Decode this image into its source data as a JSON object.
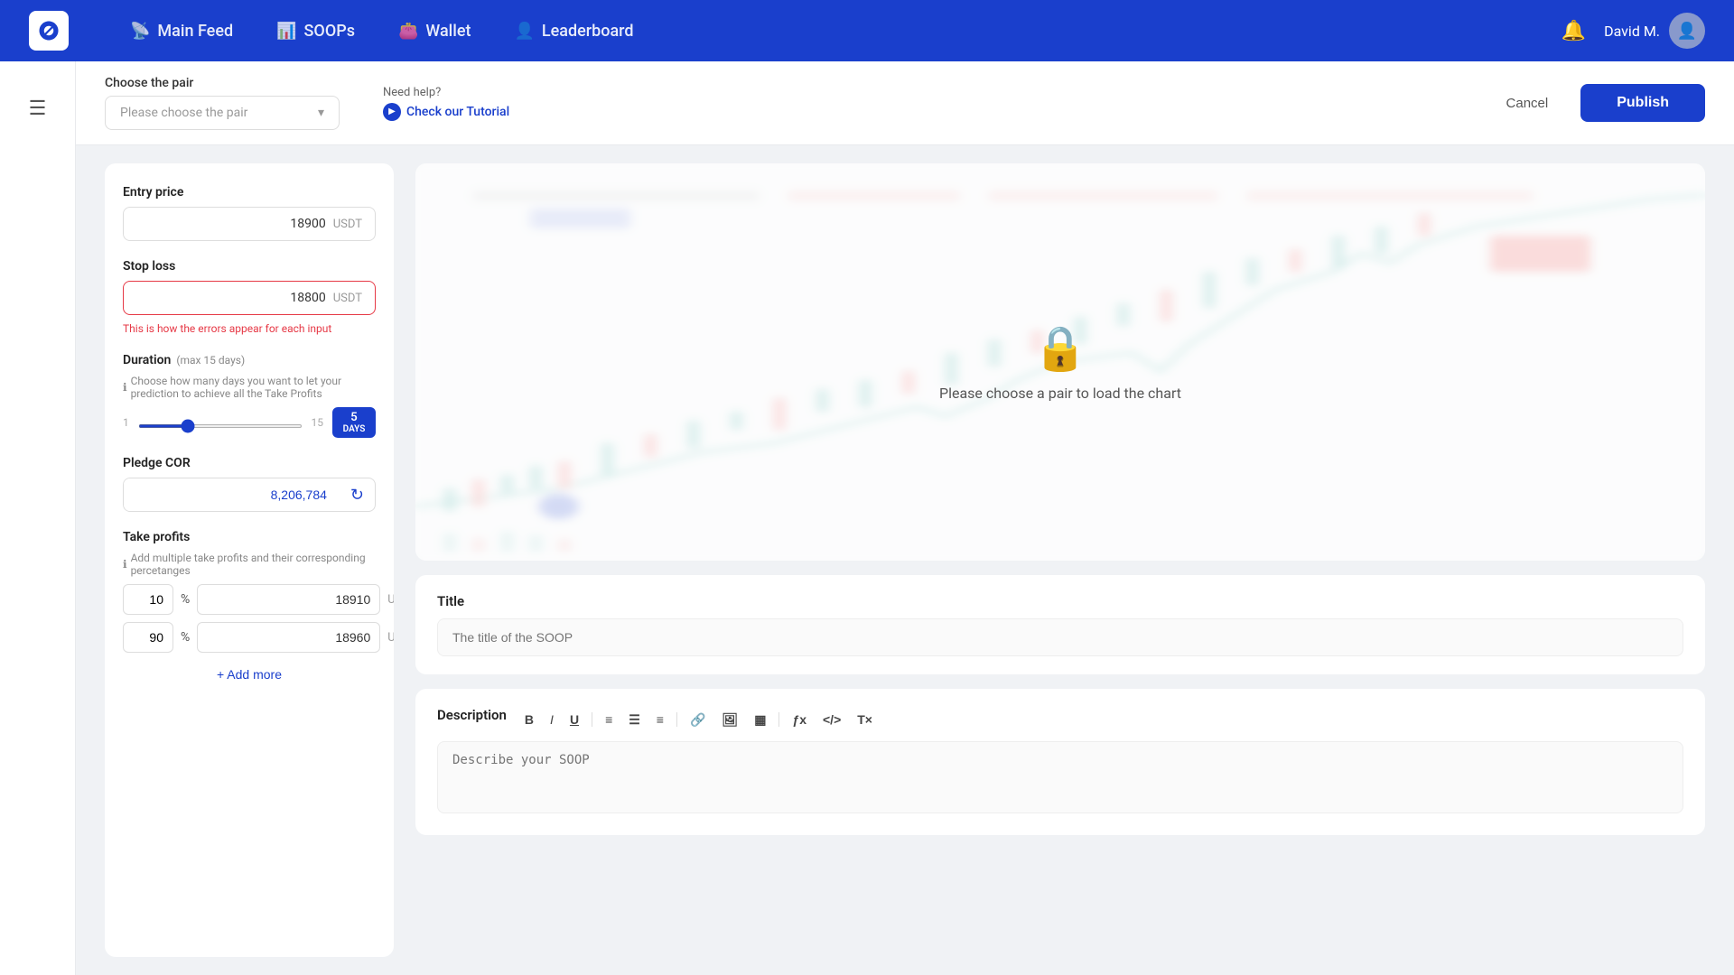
{
  "app": {
    "logo_alt": "Cryptoshots Logo"
  },
  "navbar": {
    "items": [
      {
        "id": "main-feed",
        "label": "Main Feed",
        "icon": "wifi"
      },
      {
        "id": "soops",
        "label": "SOOPs",
        "icon": "chart"
      },
      {
        "id": "wallet",
        "label": "Wallet",
        "icon": "wallet"
      },
      {
        "id": "leaderboard",
        "label": "Leaderboard",
        "icon": "person"
      }
    ],
    "user_name": "David M.",
    "bell_icon": "🔔"
  },
  "sub_header": {
    "pair_label": "Choose the pair",
    "pair_placeholder": "Please choose the pair",
    "help_label": "Need help?",
    "help_link_text": "Check our Tutorial",
    "cancel_label": "Cancel",
    "publish_label": "Publish"
  },
  "left_panel": {
    "entry_price": {
      "label": "Entry price",
      "value": "18900",
      "currency": "USDT"
    },
    "stop_loss": {
      "label": "Stop loss",
      "value": "18800",
      "currency": "USDT",
      "error_text": "This is how the errors appear for each input"
    },
    "duration": {
      "label": "Duration",
      "max_label": "(max 15 days)",
      "sublabel": "Choose how many days you want to let your prediction to achieve all the Take Profits",
      "min": "1",
      "max": "15",
      "value": "5",
      "unit": "DAYS"
    },
    "pledge_cor": {
      "label": "Pledge COR",
      "value": "8,206,784",
      "refresh_icon": "↻"
    },
    "take_profits": {
      "label": "Take profits",
      "sublabel": "Add multiple take profits and their corresponding percetanges",
      "rows": [
        {
          "percent": "10",
          "price": "18910",
          "currency": "USDT"
        },
        {
          "percent": "90",
          "price": "18960",
          "currency": "USDT"
        }
      ],
      "add_more_label": "+ Add more"
    }
  },
  "right_panel": {
    "chart": {
      "lock_text": "Please choose a pair to load the chart",
      "lock_icon": "🔒"
    },
    "title_section": {
      "label": "Title",
      "placeholder": "The title of the SOOP"
    },
    "desc_section": {
      "label": "Description",
      "placeholder": "Describe your SOOP",
      "toolbar": [
        {
          "id": "bold",
          "label": "B",
          "style": "bold"
        },
        {
          "id": "italic",
          "label": "I",
          "style": "italic"
        },
        {
          "id": "underline",
          "label": "U",
          "style": "underline"
        },
        {
          "id": "ol",
          "label": "≡",
          "style": "normal"
        },
        {
          "id": "ul",
          "label": "≡",
          "style": "normal"
        },
        {
          "id": "justify",
          "label": "≡",
          "style": "normal"
        },
        {
          "id": "link",
          "label": "🔗",
          "style": "normal"
        },
        {
          "id": "image",
          "label": "🖼",
          "style": "normal"
        },
        {
          "id": "table",
          "label": "▦",
          "style": "normal"
        },
        {
          "id": "formula",
          "label": "ƒx",
          "style": "normal"
        },
        {
          "id": "code",
          "label": "</>",
          "style": "normal"
        },
        {
          "id": "clear",
          "label": "T×",
          "style": "normal"
        }
      ]
    }
  }
}
